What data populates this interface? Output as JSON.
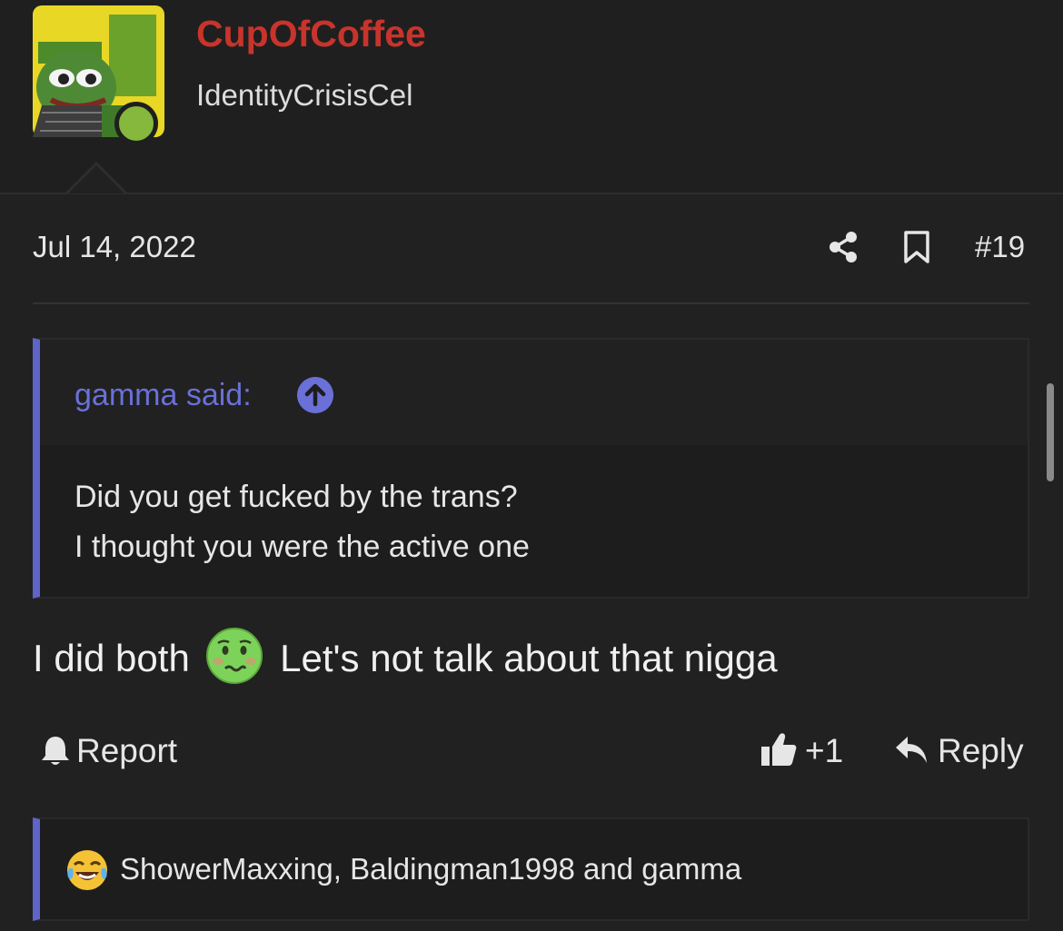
{
  "post": {
    "username": "CupOfCoffee",
    "user_title": "IdentityCrisisCel",
    "date": "Jul 14, 2022",
    "post_number": "#19",
    "quote": {
      "author": "gamma said:",
      "lines": [
        "Did you get fucked by the trans?",
        "I thought you were the active one"
      ]
    },
    "body_before_emoji": "I did both",
    "body_after_emoji": "Let's not talk about that nigga",
    "actions": {
      "report": "Report",
      "like_count": "+1",
      "reply": "Reply"
    },
    "reactions_text": "ShowerMaxxing, Baldingman1998 and gamma"
  },
  "colors": {
    "username": "#c8342c",
    "quote_accent": "#5e64c8",
    "online": "#85b83c",
    "background": "#212121"
  },
  "icons": [
    "share-icon",
    "bookmark-icon",
    "arrow-up-circle-icon",
    "bell-icon",
    "thumbs-up-icon",
    "reply-icon",
    "nauseated-face-emoji",
    "crying-laughing-face-emoji"
  ]
}
